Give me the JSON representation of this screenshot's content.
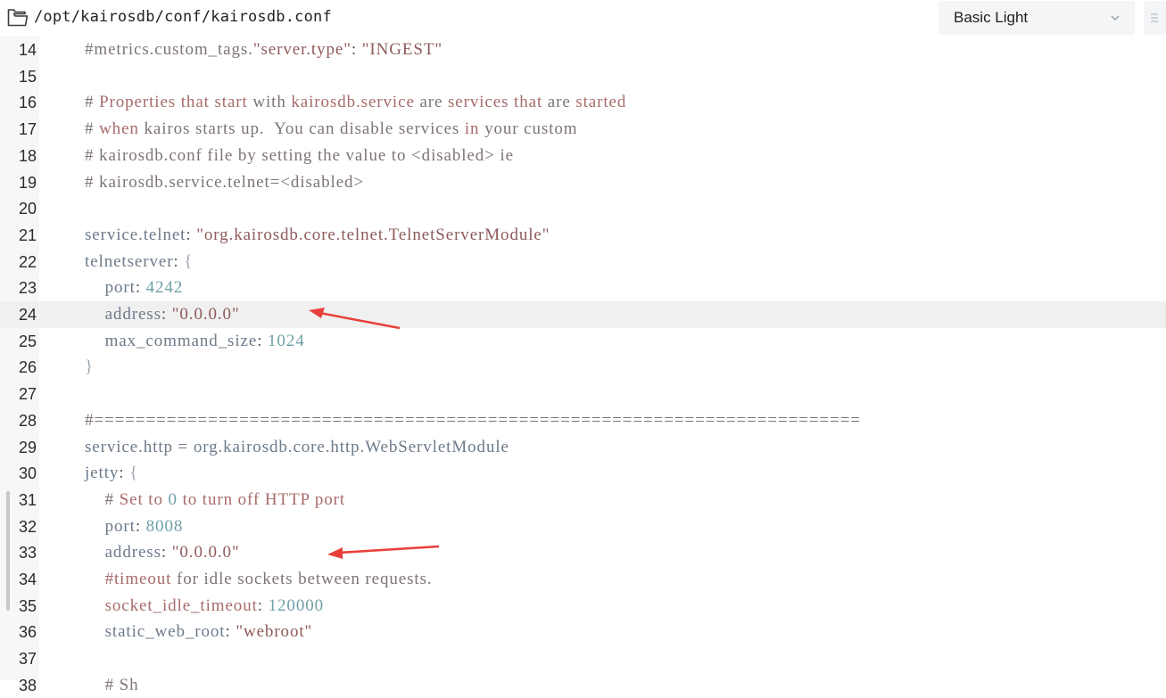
{
  "header": {
    "file_path": "/opt/kairosdb/conf/kairosdb.conf",
    "theme": "Basic Light",
    "icons": [
      "folder-icon",
      "chevron-down-icon",
      "panel-toggle-icon"
    ]
  },
  "editor": {
    "active_line": 24,
    "lines": [
      {
        "num": "14",
        "tokens": [
          {
            "t": "#metrics.custom_tags.",
            "c": "cx"
          },
          {
            "t": "\"server.type\"",
            "c": "s"
          },
          {
            "t": ": ",
            "c": "p"
          },
          {
            "t": "\"INGEST\"",
            "c": "s"
          }
        ]
      },
      {
        "num": "15",
        "tokens": []
      },
      {
        "num": "16",
        "tokens": [
          {
            "t": "# ",
            "c": "cx"
          },
          {
            "t": "Properties that start ",
            "c": "c"
          },
          {
            "t": "with",
            "c": "cx"
          },
          {
            "t": " kairosdb.service ",
            "c": "c"
          },
          {
            "t": "are",
            "c": "cx"
          },
          {
            "t": " services that ",
            "c": "c"
          },
          {
            "t": "are",
            "c": "cx"
          },
          {
            "t": " started",
            "c": "c"
          }
        ]
      },
      {
        "num": "17",
        "tokens": [
          {
            "t": "# ",
            "c": "cx"
          },
          {
            "t": "when",
            "c": "c"
          },
          {
            "t": " kairos starts up.  You can disable services ",
            "c": "cx"
          },
          {
            "t": "in",
            "c": "c"
          },
          {
            "t": " your custom",
            "c": "cx"
          }
        ]
      },
      {
        "num": "18",
        "tokens": [
          {
            "t": "# kairosdb.conf file by setting the value to <disabled> ie",
            "c": "cx"
          }
        ]
      },
      {
        "num": "19",
        "tokens": [
          {
            "t": "# kairosdb.service.telnet=<disabled>",
            "c": "cx"
          }
        ]
      },
      {
        "num": "20",
        "tokens": []
      },
      {
        "num": "21",
        "tokens": [
          {
            "t": "service.telnet",
            "c": "k"
          },
          {
            "t": ": ",
            "c": "p"
          },
          {
            "t": "\"org.kairosdb.core.telnet.TelnetServerModule\"",
            "c": "s"
          }
        ]
      },
      {
        "num": "22",
        "tokens": [
          {
            "t": "telnetserver",
            "c": "k"
          },
          {
            "t": ": ",
            "c": "p"
          },
          {
            "t": "{",
            "c": "b"
          }
        ]
      },
      {
        "num": "23",
        "tokens": [
          {
            "t": "    port",
            "c": "k"
          },
          {
            "t": ": ",
            "c": "p"
          },
          {
            "t": "4242",
            "c": "n"
          }
        ]
      },
      {
        "num": "24",
        "tokens": [
          {
            "t": "    address",
            "c": "k"
          },
          {
            "t": ": ",
            "c": "p"
          },
          {
            "t": "\"0.0.0.0\"",
            "c": "s"
          }
        ]
      },
      {
        "num": "25",
        "tokens": [
          {
            "t": "    max_command_size",
            "c": "k"
          },
          {
            "t": ": ",
            "c": "p"
          },
          {
            "t": "1024",
            "c": "n"
          }
        ]
      },
      {
        "num": "26",
        "tokens": [
          {
            "t": "}",
            "c": "b"
          }
        ]
      },
      {
        "num": "27",
        "tokens": []
      },
      {
        "num": "28",
        "tokens": [
          {
            "t": "#==========================================================================",
            "c": "cx"
          }
        ]
      },
      {
        "num": "29",
        "tokens": [
          {
            "t": "service.http = org.kairosdb.core.http.WebServletModule",
            "c": "k"
          }
        ]
      },
      {
        "num": "30",
        "tokens": [
          {
            "t": "jetty",
            "c": "k"
          },
          {
            "t": ": ",
            "c": "p"
          },
          {
            "t": "{",
            "c": "b"
          }
        ]
      },
      {
        "num": "31",
        "tokens": [
          {
            "t": "    # ",
            "c": "cx"
          },
          {
            "t": "Set to ",
            "c": "c"
          },
          {
            "t": "0",
            "c": "n"
          },
          {
            "t": " to turn off HTTP port",
            "c": "c"
          }
        ]
      },
      {
        "num": "32",
        "tokens": [
          {
            "t": "    port",
            "c": "k"
          },
          {
            "t": ": ",
            "c": "p"
          },
          {
            "t": "8008",
            "c": "n"
          }
        ]
      },
      {
        "num": "33",
        "tokens": [
          {
            "t": "    address",
            "c": "k"
          },
          {
            "t": ": ",
            "c": "p"
          },
          {
            "t": "\"0.0.0.0\"",
            "c": "s"
          }
        ]
      },
      {
        "num": "34",
        "tokens": [
          {
            "t": "    #timeout ",
            "c": "c"
          },
          {
            "t": "for idle sockets between requests.",
            "c": "cx"
          }
        ]
      },
      {
        "num": "35",
        "tokens": [
          {
            "t": "    socket_idle_timeout",
            "c": "c"
          },
          {
            "t": ": ",
            "c": "p"
          },
          {
            "t": "120000",
            "c": "n"
          }
        ]
      },
      {
        "num": "36",
        "tokens": [
          {
            "t": "    static_web_root",
            "c": "k"
          },
          {
            "t": ": ",
            "c": "p"
          },
          {
            "t": "\"webroot\"",
            "c": "s"
          }
        ]
      },
      {
        "num": "37",
        "tokens": []
      },
      {
        "num": "38",
        "tokens": [
          {
            "t": "    # Sh",
            "c": "cx"
          }
        ]
      }
    ]
  },
  "colors": {
    "arrow": "#e8403a",
    "active_line": "#f0f0f0",
    "gutter": "#f7f7f7",
    "theme_select_bg": "#f4f5f7"
  }
}
